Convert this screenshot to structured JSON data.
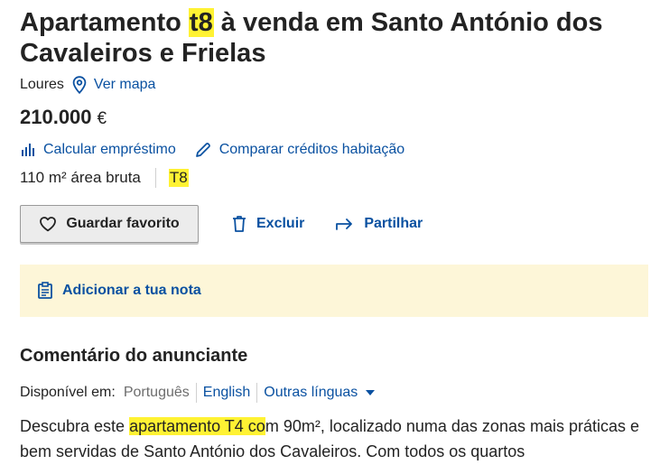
{
  "listing": {
    "title_pre": "Apartamento ",
    "title_hl": "t8",
    "title_post": " à venda em Santo António dos Cavaleiros e Frielas",
    "city": "Loures",
    "map_link": "Ver mapa",
    "price": "210.000",
    "currency": "€",
    "tool_loan": "Calcular empréstimo",
    "tool_compare": "Comparar créditos habitação",
    "area": "110 m² área bruta",
    "typology": "T8"
  },
  "actions": {
    "favorite": "Guardar favorito",
    "delete": "Excluir",
    "share": "Partilhar"
  },
  "note": {
    "label": "Adicionar a tua nota"
  },
  "comment": {
    "title": "Comentário do anunciante",
    "available_label": "Disponível em:",
    "languages": [
      "Português",
      "English"
    ],
    "more_languages": "Outras línguas",
    "desc_pre": "Descubra este ",
    "desc_hl": "apartamento T4 co",
    "desc_post": "m 90m², localizado numa das zonas mais práticas e bem servidas de Santo António dos Cavaleiros. Com todos os quartos"
  },
  "colors": {
    "link": "#0a51a1",
    "highlight": "#fff233",
    "note_bg": "#fdf6d8"
  },
  "icons": [
    "map-pin-icon",
    "bar-chart-icon",
    "pencil-icon",
    "heart-icon",
    "trash-icon",
    "share-arrow-icon",
    "note-icon",
    "caret-down-icon"
  ]
}
